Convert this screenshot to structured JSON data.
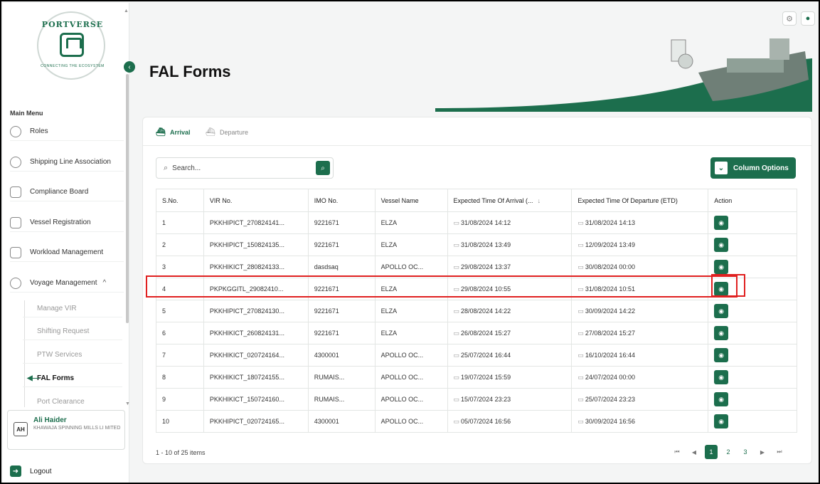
{
  "app": {
    "logo_top_text": "PORTVERSE",
    "logo_bottom_text": "CONNECTING THE ECOSYSTEM"
  },
  "sidebar": {
    "menu_title": "Main Menu",
    "items": [
      {
        "label": "Roles",
        "icon": "roles-icon"
      },
      {
        "label": "Shipping Line Association",
        "icon": "shipping-icon"
      },
      {
        "label": "Compliance Board",
        "icon": "compliance-icon"
      },
      {
        "label": "Vessel Registration",
        "icon": "vessel-icon"
      },
      {
        "label": "Workload Management",
        "icon": "workload-icon"
      },
      {
        "label": "Voyage Management",
        "icon": "voyage-icon"
      }
    ],
    "sub_items": [
      {
        "label": "Manage VIR"
      },
      {
        "label": "Shifting Request"
      },
      {
        "label": "PTW Services"
      },
      {
        "label": "FAL Forms"
      },
      {
        "label": "Port Clearance"
      }
    ],
    "user": {
      "initials": "AH",
      "name": "Ali Haider",
      "org": "KHAWAJA SPINNING MILLS LI MITED"
    },
    "logout_label": "Logout"
  },
  "header": {
    "title": "FAL Forms"
  },
  "tabs": [
    {
      "label": "Arrival",
      "active": true
    },
    {
      "label": "Departure",
      "active": false
    }
  ],
  "search": {
    "placeholder": "Search..."
  },
  "column_options_label": "Column Options",
  "table": {
    "headers": [
      "S.No.",
      "VIR No.",
      "IMO No.",
      "Vessel Name",
      "Expected Time Of Arrival (...",
      "Expected Time Of Departure (ETD)",
      "Action"
    ],
    "rows": [
      [
        "1",
        "PKKHIPICT_270824141...",
        "9221671",
        "ELZA",
        "31/08/2024 14:12",
        "31/08/2024 14:13"
      ],
      [
        "2",
        "PKKHIPICT_150824135...",
        "9221671",
        "ELZA",
        "31/08/2024 13:49",
        "12/09/2024 13:49"
      ],
      [
        "3",
        "PKKHIKICT_280824133...",
        "dasdsaq",
        "APOLLO OC...",
        "29/08/2024 13:37",
        "30/08/2024 00:00"
      ],
      [
        "4",
        "PKPKGGITL_29082410...",
        "9221671",
        "ELZA",
        "29/08/2024 10:55",
        "31/08/2024 10:51"
      ],
      [
        "5",
        "PKKHIPICT_270824130...",
        "9221671",
        "ELZA",
        "28/08/2024 14:22",
        "30/09/2024 14:22"
      ],
      [
        "6",
        "PKKHIKICT_260824131...",
        "9221671",
        "ELZA",
        "26/08/2024 15:27",
        "27/08/2024 15:27"
      ],
      [
        "7",
        "PKKHIKICT_020724164...",
        "4300001",
        "APOLLO OC...",
        "25/07/2024 16:44",
        "16/10/2024 16:44"
      ],
      [
        "8",
        "PKKHIKICT_180724155...",
        "RUMAIS...",
        "APOLLO OC...",
        "19/07/2024 15:59",
        "24/07/2024 00:00"
      ],
      [
        "9",
        "PKKHIKICT_150724160...",
        "RUMAIS...",
        "APOLLO OC...",
        "15/07/2024 23:23",
        "25/07/2024 23:23"
      ],
      [
        "10",
        "PKKHIPICT_020724165...",
        "4300001",
        "APOLLO OC...",
        "05/07/2024 16:56",
        "30/09/2024 16:56"
      ]
    ]
  },
  "pagination": {
    "info": "1 - 10 of 25 items",
    "pages": [
      "1",
      "2",
      "3"
    ],
    "current": "1"
  },
  "colors": {
    "brand": "#1c6e4d",
    "highlight": "#e02020"
  }
}
